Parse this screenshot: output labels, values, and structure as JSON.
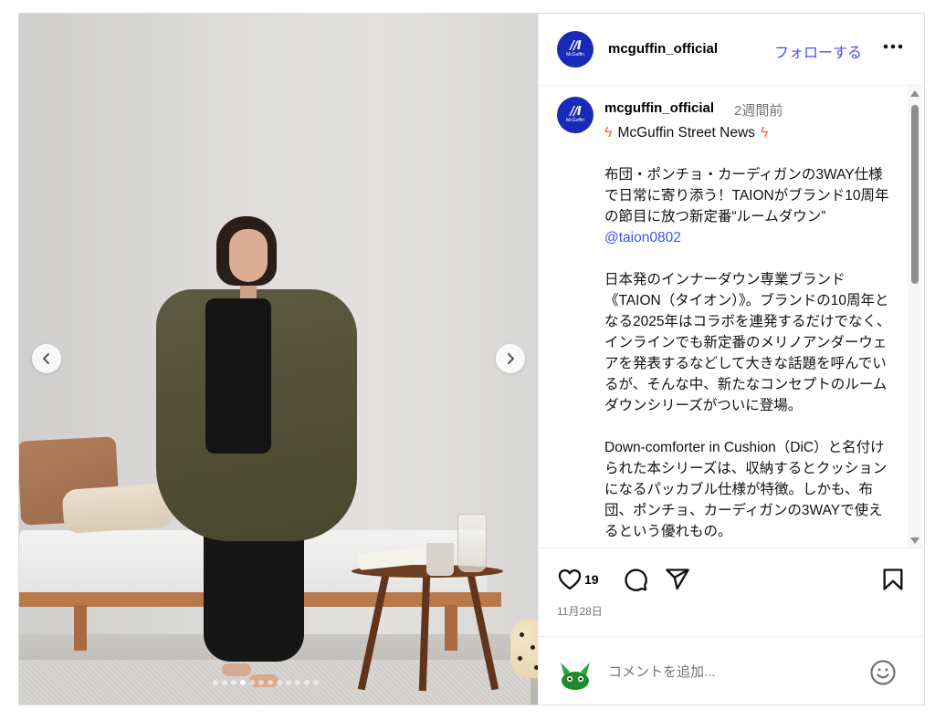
{
  "account": {
    "username": "mcguffin_official",
    "avatar_logo_mark": "/∕I",
    "avatar_logo_text": "McGuffin",
    "avatar_color": "#1a2ab8"
  },
  "header": {
    "follow_label": "フォローする",
    "more_icon": "more-horizontal-icon"
  },
  "caption": {
    "username": "mcguffin_official",
    "time_ago": "2週間前",
    "news_title": "McGuffin Street News",
    "news_icon": "lightning-icon",
    "headline": "布団・ポンチョ・カーディガンの3WAY仕様で日常に寄り添う！TAIONがブランド10周年の節目に放つ新定番“ルームダウン”",
    "mention": "@taion0802",
    "paragraph1": "日本発のインナーダウン専業ブランド《TAION（タイオン）》。ブランドの10周年となる2025年はコラボを連発するだけでなく、インラインでも新定番のメリノアンダーウェアを発表するなどして大きな話題を呼んでいるが、そんな中、新たなコンセプトのルームダウンシリーズがついに登場。",
    "paragraph2": "Down-comforter in Cushion（DiC）と名付けられた本シリーズは、収納するとクッションになるパッカブル仕様が特徴。しかも、布団、ポンチョ、カーディガンの3WAYで使えるという優れもの。"
  },
  "actions": {
    "like_icon": "heart-icon",
    "like_count": "19",
    "comment_icon": "comment-icon",
    "share_icon": "send-icon",
    "save_icon": "bookmark-icon",
    "date": "11月28日"
  },
  "comment": {
    "placeholder": "コメントを追加...",
    "emoji_icon": "emoji-icon",
    "avatar_icon": "user-avatar-icon"
  },
  "carousel": {
    "prev_icon": "chevron-left-icon",
    "next_icon": "chevron-right-icon",
    "slide_count": 12,
    "active_index": 3
  },
  "colors": {
    "link": "#4150f7",
    "accent_bolt": "#f46a2a",
    "muted": "#737373"
  }
}
